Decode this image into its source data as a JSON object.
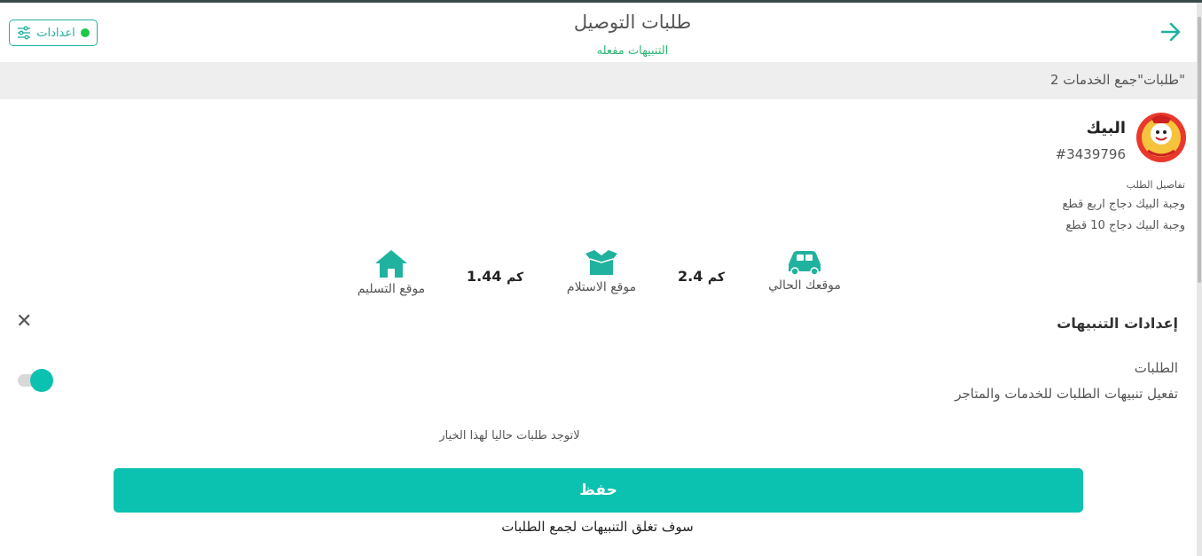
{
  "header": {
    "title": "طلبات التوصيل",
    "subtitle": "التنبيهات مفعله",
    "settings_label": "اعدادات",
    "status_color": "#1ec84a",
    "accent_color": "#20b29f"
  },
  "category": {
    "label": "\"طلبات\"جمع الخدمات 2"
  },
  "order": {
    "store_name": "البيك",
    "order_number": "#3439796",
    "details_label": "تفاصيل الطلب",
    "items": [
      "وجبة البيك دجاج اربع قطع",
      "وجبة البيك دجاج 10 قطع"
    ],
    "metrics": {
      "current_location_label": "موقعك الحالي",
      "current_icon": "car-icon",
      "pickup_label": "موقع الاستلام",
      "pickup_icon": "box-icon",
      "delivery_label": "موقع التسليم",
      "delivery_icon": "home-icon",
      "distance_1_value": "2.4",
      "distance_2_value": "1.44",
      "distance_unit": "كم"
    }
  },
  "notifications_sheet": {
    "title": "إعدادات التنبيهات",
    "toggle_title": "الطلبات",
    "toggle_desc": "تفعيل تنبيهات الطلبات للخدمات والمتاجر",
    "toggle_on": true,
    "empty_message": "لاتوجد طلبات حاليا لهذا الخيار",
    "save_label": "حفظ",
    "footer_note": "سوف تغلق التنبيهات لجمع الطلبات",
    "button_color": "#0bc1b0"
  }
}
